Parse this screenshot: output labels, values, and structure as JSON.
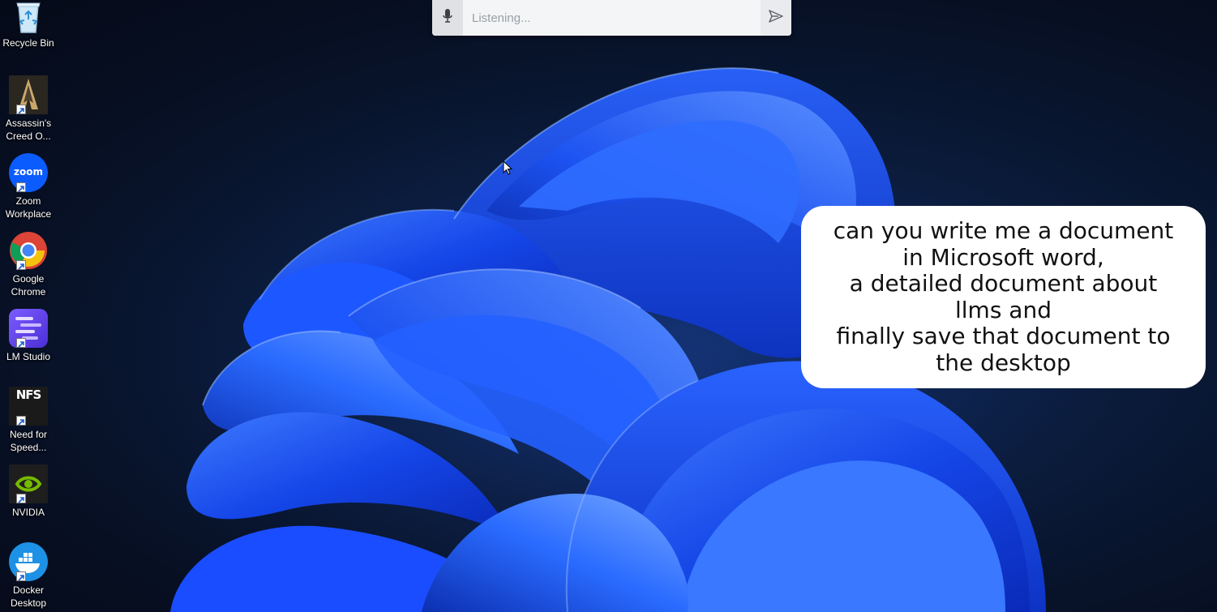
{
  "desktop_icons": [
    {
      "label": "Recycle Bin",
      "icon": "recycle-bin-icon",
      "shortcut": false
    },
    {
      "label": "Assassin's\nCreed O...",
      "icon": "assassins-creed-icon",
      "shortcut": true
    },
    {
      "label": "Zoom\nWorkplace",
      "icon": "zoom-icon",
      "icon_text": "zoom",
      "shortcut": true
    },
    {
      "label": "Google\nChrome",
      "icon": "chrome-icon",
      "shortcut": true
    },
    {
      "label": "LM Studio",
      "icon": "lm-studio-icon",
      "shortcut": true
    },
    {
      "label": "Need for\nSpeed...",
      "icon": "need-for-speed-icon",
      "icon_text": "NFS",
      "shortcut": true
    },
    {
      "label": "NVIDIA",
      "icon": "nvidia-icon",
      "shortcut": true
    },
    {
      "label": "Docker\nDesktop",
      "icon": "docker-icon",
      "shortcut": true
    }
  ],
  "listen_bar": {
    "placeholder": "Listening...",
    "value": "",
    "mic_icon": "microphone-icon",
    "send_icon": "send-icon"
  },
  "caption": {
    "text": "can you write me a document\nin Microsoft word,\na detailed document about\nllms and\nfinally save that document to\nthe desktop"
  },
  "colors": {
    "wallpaper_bg": "#070f22",
    "bloom_blue": "#1a4dff",
    "bar_bg": "#f4f5f7"
  }
}
